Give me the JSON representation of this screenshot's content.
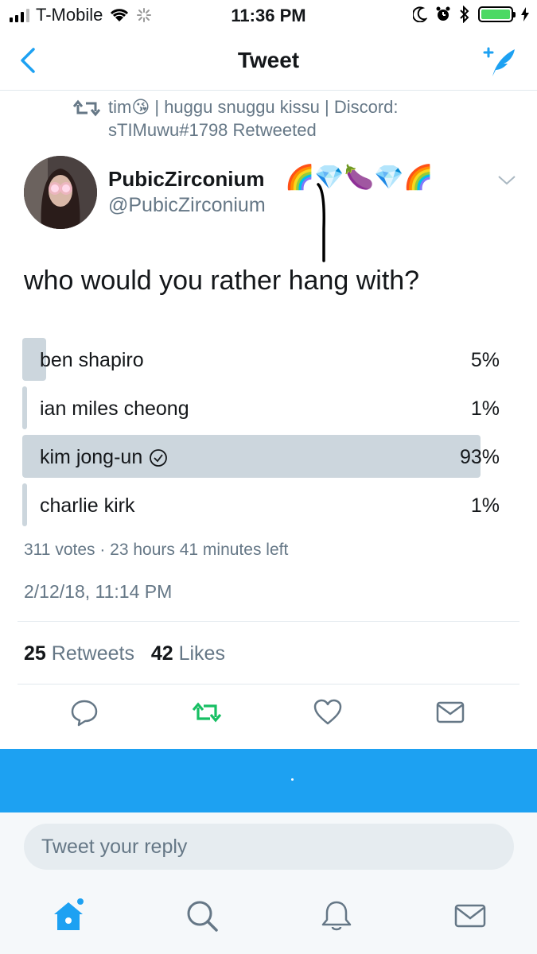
{
  "status_bar": {
    "carrier": "T-Mobile",
    "time": "11:36 PM"
  },
  "nav": {
    "title": "Tweet"
  },
  "retweet_context": {
    "line1": "tim😘 | huggu snuggu kissu | Discord:",
    "line2": "sTIMuwu#1798 Retweeted"
  },
  "tweet": {
    "author_name": "PubicZirconium",
    "author_emojis": "🌈💎🍆💎🌈",
    "author_handle": "@PubicZirconium",
    "text": "who would you rather hang with?",
    "poll": {
      "options": [
        {
          "label": "ben shapiro",
          "percent_text": "5%",
          "fraction": 0.05,
          "selected": false
        },
        {
          "label": "ian miles cheong",
          "percent_text": "1%",
          "fraction": 0.01,
          "selected": false
        },
        {
          "label": "kim jong-un",
          "percent_text": "93%",
          "fraction": 0.96,
          "selected": true
        },
        {
          "label": "charlie kirk",
          "percent_text": "1%",
          "fraction": 0.01,
          "selected": false
        }
      ],
      "meta": "311 votes · 23 hours 41 minutes left"
    },
    "timestamp": "2/12/18, 11:14 PM",
    "stats": {
      "retweets_count": "25",
      "retweets_label": "Retweets",
      "likes_count": "42",
      "likes_label": "Likes"
    }
  },
  "reply": {
    "placeholder": "Tweet your reply"
  },
  "colors": {
    "accent": "#1da1f2",
    "retweet_green": "#17bf63",
    "muted": "#657786",
    "poll_bar": "#ccd6dd"
  }
}
